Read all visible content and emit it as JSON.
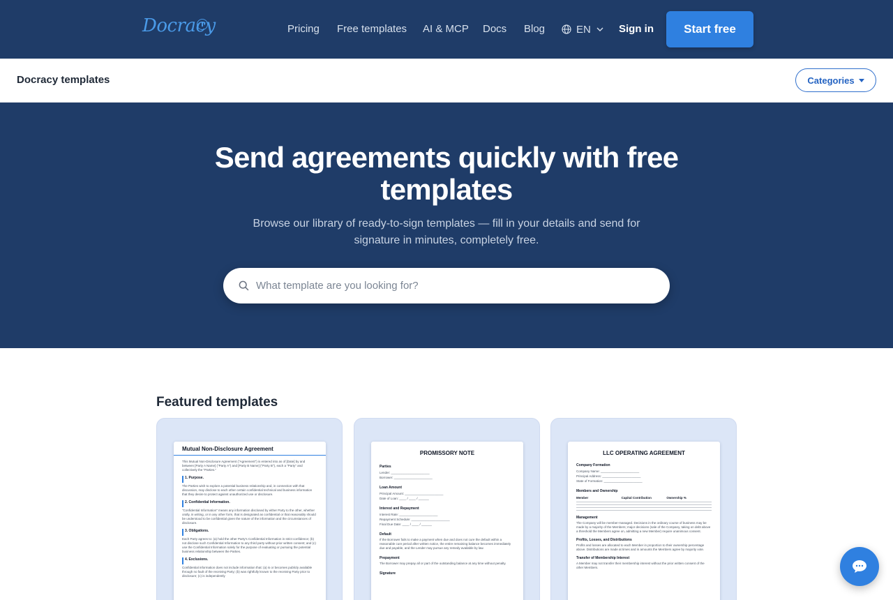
{
  "header": {
    "logo_text": "Docracy",
    "nav": [
      "Pricing",
      "Free templates",
      "AI & MCP",
      "Docs",
      "Blog"
    ],
    "lang": "EN",
    "signin": "Sign in",
    "cta": "Start free"
  },
  "subheader": {
    "title": "Docracy templates",
    "categories": "Categories"
  },
  "hero": {
    "title": "Send agreements quickly with free templates",
    "subtitle": "Browse our library of ready-to-sign templates — fill in your details and send for signature in minutes, completely free.",
    "search_placeholder": "What template are you looking for?"
  },
  "featured": {
    "title": "Featured templates",
    "cards": [
      {
        "doc_title": "Mutual Non-Disclosure Agreement",
        "intro": "This Mutual Non-Disclosure Agreement (\"Agreement\") is entered into as of [Date] by and between [Party A Name] (\"Party A\") and [Party B Name] (\"Party B\"), each a \"Party\" and collectively the \"Parties.\"",
        "sections": [
          {
            "h": "1. Purpose.",
            "t": "The Parties wish to explore a potential business relationship and, in connection with that discussion, may disclose to each other certain confidential technical and business information that they desire to protect against unauthorized use or disclosure."
          },
          {
            "h": "2. Confidential Information.",
            "t": "\"Confidential Information\" means any information disclosed by either Party to the other, whether orally, in writing, or in any other form, that is designated as confidential or that reasonably should be understood to be confidential given the nature of the information and the circumstances of disclosure."
          },
          {
            "h": "3. Obligations.",
            "t": "Each Party agrees to: (a) hold the other Party's Confidential Information in strict confidence; (b) not disclose such Confidential Information to any third party without prior written consent; and (c) use the Confidential Information solely for the purpose of evaluating or pursuing the potential business relationship between the Parties."
          },
          {
            "h": "4. Exclusions.",
            "t": "Confidential information does not include information that: (a) is or becomes publicly available through no fault of the receiving Party; (b) was rightfully known to the receiving Party prior to disclosure; (c) is independently"
          }
        ]
      },
      {
        "doc_title": "PROMISSORY NOTE",
        "sections": [
          {
            "h": "Parties",
            "fields": [
              "Lender: ______________________",
              "Borrower: ______________________"
            ]
          },
          {
            "h": "Loan Amount",
            "fields": [
              "Principal Amount: ______________________",
              "Date of Loan: ____ / ____ / ______"
            ]
          },
          {
            "h": "Interest and Repayment",
            "fields": [
              "Interest Rate: ______________________",
              "Repayment Schedule: ______________________",
              "Final Due Date: ____ / ____ / ______"
            ]
          },
          {
            "h": "Default",
            "text": "If the Borrower fails to make a payment when due and does not cure the default within a reasonable cure period after written notice, the entire remaining balance becomes immediately due and payable, and the Lender may pursue any remedy available by law."
          },
          {
            "h": "Prepayment",
            "text": "The Borrower may prepay all or part of the outstanding balance at any time without penalty."
          },
          {
            "h": "Signature"
          }
        ]
      },
      {
        "doc_title": "LLC OPERATING AGREEMENT",
        "sections": [
          {
            "h": "Company Formation",
            "fields": [
              "Company Name: ______________________",
              "Principal Address: ______________________",
              "State of Formation: ______________________"
            ]
          },
          {
            "h": "Members and Ownership",
            "cols": [
              "Member",
              "Capital Contribution",
              "Ownership %"
            ]
          },
          {
            "h": "Management",
            "text": "The Company will be member-managed. Decisions in the ordinary course of business may be made by a majority of the Members; major decisions (sale of the Company, taking on debt above a threshold the Members agree on, admitting a new Member) require unanimous consent."
          },
          {
            "h": "Profits, Losses, and Distributions",
            "text": "Profits and losses are allocated to each Member in proportion to their ownership percentage above. Distributions are made at times and in amounts the Members agree by majority vote."
          },
          {
            "h": "Transfer of Membership Interest",
            "text": "A Member may not transfer their membership interest without the prior written consent of the other Members."
          }
        ]
      }
    ]
  },
  "colors": {
    "nav_bg": "#1f3c68",
    "accent": "#2f80e0",
    "card_bg": "#dce6f7"
  }
}
